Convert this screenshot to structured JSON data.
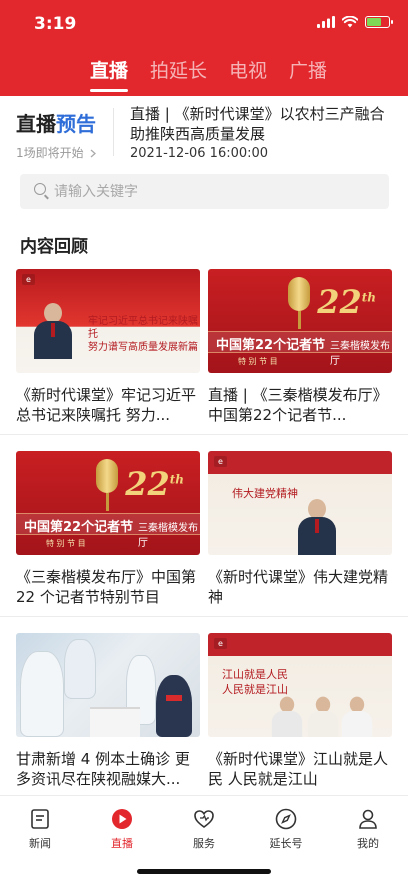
{
  "status": {
    "time": "3:19",
    "battery_level": 0.65,
    "battery_color": "#7ed957"
  },
  "colors": {
    "brand": "#e2272d",
    "accent": "#2f6ed8"
  },
  "top_tabs": [
    {
      "label": "直播",
      "active": true
    },
    {
      "label": "拍延长",
      "active": false
    },
    {
      "label": "电视",
      "active": false
    },
    {
      "label": "广播",
      "active": false
    }
  ],
  "preview": {
    "title_main": "直播",
    "title_accent": "预告",
    "count_text": "1场即将开始",
    "headline": "直播 | 《新时代课堂》以农村三产融合助推陕西高质量发展",
    "date": "2021-12-06 16:00:00"
  },
  "search": {
    "placeholder": "请输入关键字",
    "value": ""
  },
  "section_title": "内容回顾",
  "cards": [
    {
      "title": "《新时代课堂》牢记习近平总书记来陕嘱托 努力...",
      "thumb_lines": [
        "牢记习近平总书记来陕嘱托",
        "努力谱写高质量发展新篇"
      ]
    },
    {
      "title": "直播 | 《三秦楷模发布厅》中国第22个记者节...",
      "thumb_band": "中国第22个记者节",
      "thumb_sub": "特 别 节 目",
      "thumb_script": "三秦楷模发布厅",
      "thumb_number": "22",
      "thumb_suffix": "th"
    },
    {
      "title": "《三秦楷模发布厅》中国第 22 个记者节特别节目",
      "thumb_band": "中国第22个记者节",
      "thumb_sub": "特 别 节 目",
      "thumb_script": "三秦楷模发布厅",
      "thumb_number": "22",
      "thumb_suffix": "th"
    },
    {
      "title": "《新时代课堂》伟大建党精神",
      "thumb_lines": [
        "伟大建党精神"
      ]
    },
    {
      "title": "甘肃新增 4 例本土确诊 更多资讯尽在陕视融媒大...",
      "thumb_lines": []
    },
    {
      "title": "《新时代课堂》江山就是人民 人民就是江山",
      "thumb_lines": [
        "江山就是人民",
        "人民就是江山"
      ]
    }
  ],
  "tabbar": [
    {
      "label": "新闻",
      "icon": "news-icon",
      "active": false
    },
    {
      "label": "直播",
      "icon": "live-play-icon",
      "active": true
    },
    {
      "label": "服务",
      "icon": "service-heart-icon",
      "active": false
    },
    {
      "label": "延长号",
      "icon": "compass-icon",
      "active": false
    },
    {
      "label": "我的",
      "icon": "profile-icon",
      "active": false
    }
  ]
}
